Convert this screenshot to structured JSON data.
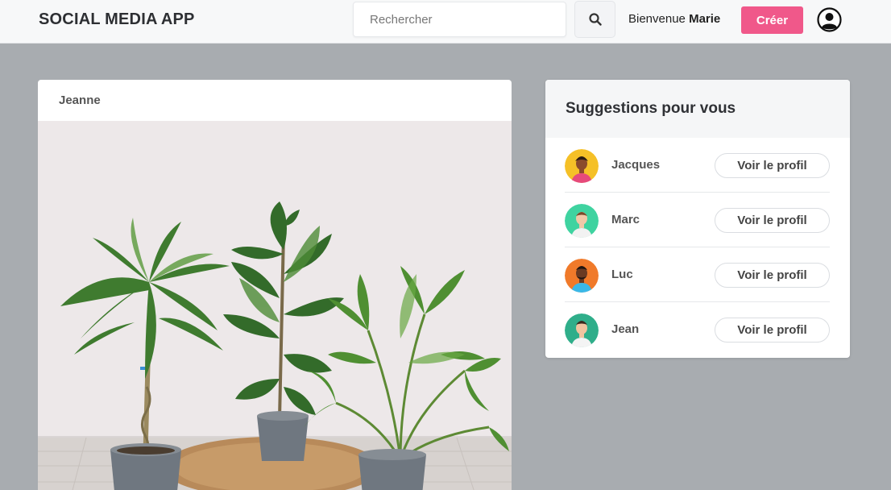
{
  "header": {
    "brand": "SOCIAL MEDIA APP",
    "search_placeholder": "Rechercher",
    "search_icon": "search-icon",
    "welcome_prefix": "Bienvenue",
    "welcome_user": "Marie",
    "create_label": "Créer",
    "user_icon": "user-circle-icon"
  },
  "post": {
    "author": "Jeanne",
    "image_subject": "potted-plants-photo"
  },
  "suggestions": {
    "title": "Suggestions pour vous",
    "items": [
      {
        "name": "Jacques",
        "button": "Voir le profil",
        "avatar_color": "#f5c027"
      },
      {
        "name": "Marc",
        "button": "Voir le profil",
        "avatar_color": "#3fd3a0"
      },
      {
        "name": "Luc",
        "button": "Voir le profil",
        "avatar_color": "#f07a2a"
      },
      {
        "name": "Jean",
        "button": "Voir le profil",
        "avatar_color": "#2fae8a"
      }
    ]
  },
  "colors": {
    "accent": "#f0588a",
    "background": "#a8acb0"
  }
}
